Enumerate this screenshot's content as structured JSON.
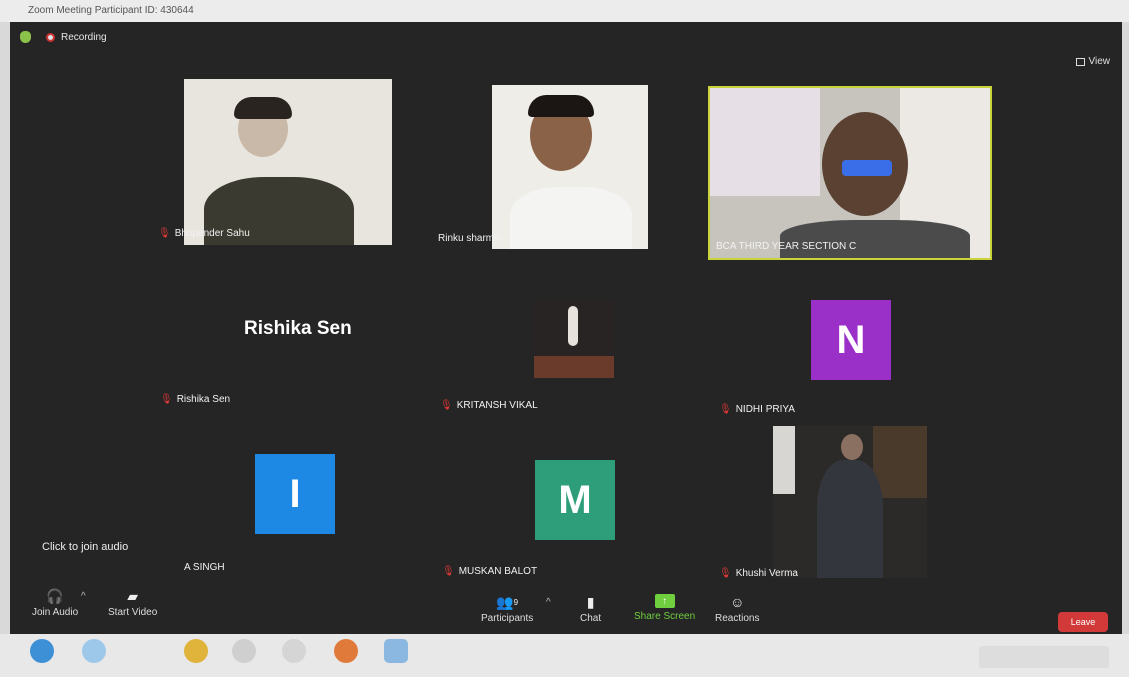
{
  "window": {
    "title": "Zoom Meeting Participant ID: 430644"
  },
  "top": {
    "recording": "Recording",
    "view": "View"
  },
  "tiles": [
    {
      "name": "Bhupender Sahu",
      "type": "video"
    },
    {
      "name": "Rinku sharma",
      "type": "video"
    },
    {
      "name": "BCA THIRD YEAR SECTION C",
      "type": "video"
    },
    {
      "name": "Rishika Sen",
      "display": "Rishika Sen",
      "type": "name"
    },
    {
      "name": "KRITANSH VIKAL",
      "type": "video"
    },
    {
      "name": "NIDHI PRIYA",
      "letter": "N",
      "color": "#9b30c8",
      "type": "avatar"
    },
    {
      "name": "A SINGH",
      "letter": "I",
      "color": "#1e88e5",
      "type": "avatar"
    },
    {
      "name": "MUSKAN BALOT",
      "letter": "M",
      "color": "#2e9e7a",
      "type": "avatar"
    },
    {
      "name": "Khushi Verma",
      "type": "video"
    }
  ],
  "audio_prompt": "Click to join audio",
  "toolbar": {
    "join_audio": "Join Audio",
    "start_video": "Start Video",
    "participants": "Participants",
    "participants_count": "9",
    "chat": "Chat",
    "share_screen": "Share Screen",
    "reactions": "Reactions",
    "leave": "Leave"
  },
  "icons": [
    "shield-icon",
    "record-icon",
    "view-icon",
    "mic-muted-icon",
    "headphones-icon",
    "video-off-icon",
    "participants-icon",
    "chat-icon",
    "share-screen-icon",
    "reactions-icon"
  ]
}
